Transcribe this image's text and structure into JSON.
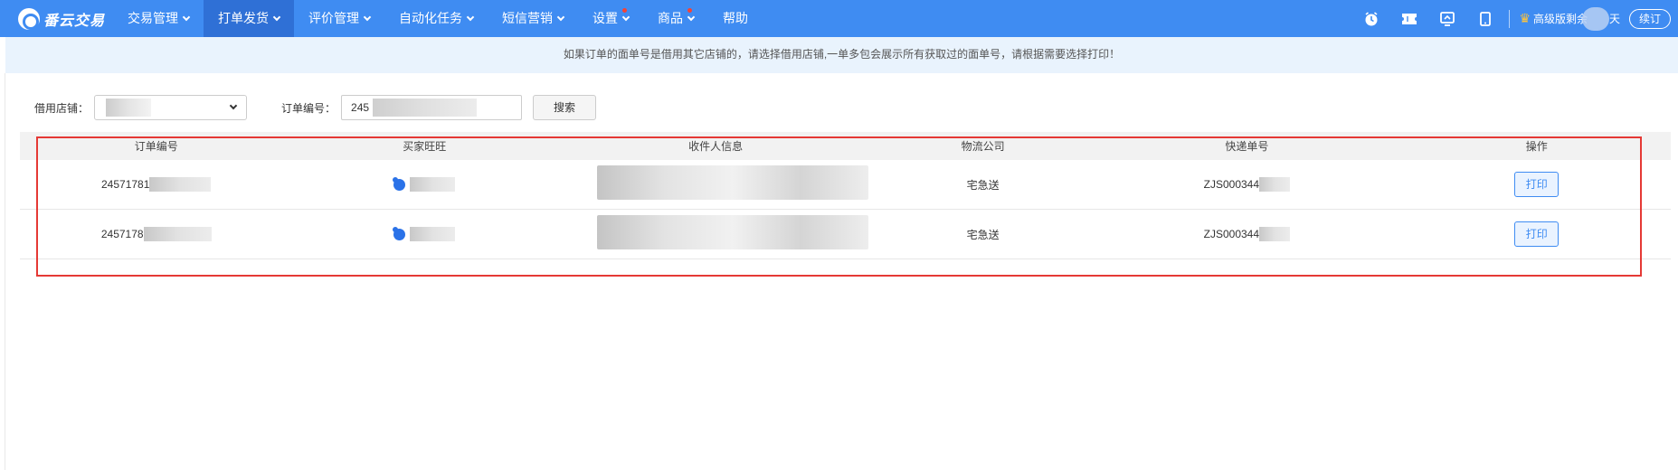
{
  "app": {
    "name": "番云交易"
  },
  "nav": [
    {
      "label": "交易管理",
      "caret": true,
      "dot": false,
      "active": false
    },
    {
      "label": "打单发货",
      "caret": true,
      "dot": false,
      "active": true
    },
    {
      "label": "评价管理",
      "caret": true,
      "dot": false,
      "active": false
    },
    {
      "label": "自动化任务",
      "caret": true,
      "dot": false,
      "active": false
    },
    {
      "label": "短信营销",
      "caret": true,
      "dot": false,
      "active": false
    },
    {
      "label": "设置",
      "caret": true,
      "dot": true,
      "active": false
    },
    {
      "label": "商品",
      "caret": true,
      "dot": true,
      "active": false
    },
    {
      "label": "帮助",
      "caret": false,
      "dot": false,
      "active": false
    }
  ],
  "topRight": {
    "vip_label": "高级版剩余",
    "vip_suffix": "天",
    "renew_label": "续订"
  },
  "notice": "如果订单的面单号是借用其它店铺的，请选择借用店铺,一单多包会展示所有获取过的面单号，请根据需要选择打印！",
  "filters": {
    "shop_label": "借用店铺：",
    "order_label": "订单编号：",
    "order_value": "245",
    "search_label": "搜索"
  },
  "table": {
    "headers": [
      "订单编号",
      "买家旺旺",
      "收件人信息",
      "物流公司",
      "快递单号",
      "操作"
    ],
    "rows": [
      {
        "order_no": "24571781",
        "logistics": "宅急送",
        "tracking": "ZJS000344",
        "action": "打印"
      },
      {
        "order_no": "2457178",
        "logistics": "宅急送",
        "tracking": "ZJS000344",
        "action": "打印"
      }
    ]
  },
  "colors": {
    "nav_bg": "#3f8cf2",
    "nav_active": "#2f70d6",
    "notice_bg": "#e9f3fd",
    "highlight": "#e53935"
  },
  "icons": [
    "alarm-clock-icon",
    "ticket-icon",
    "screen-icon",
    "tablet-icon",
    "crown-icon"
  ]
}
